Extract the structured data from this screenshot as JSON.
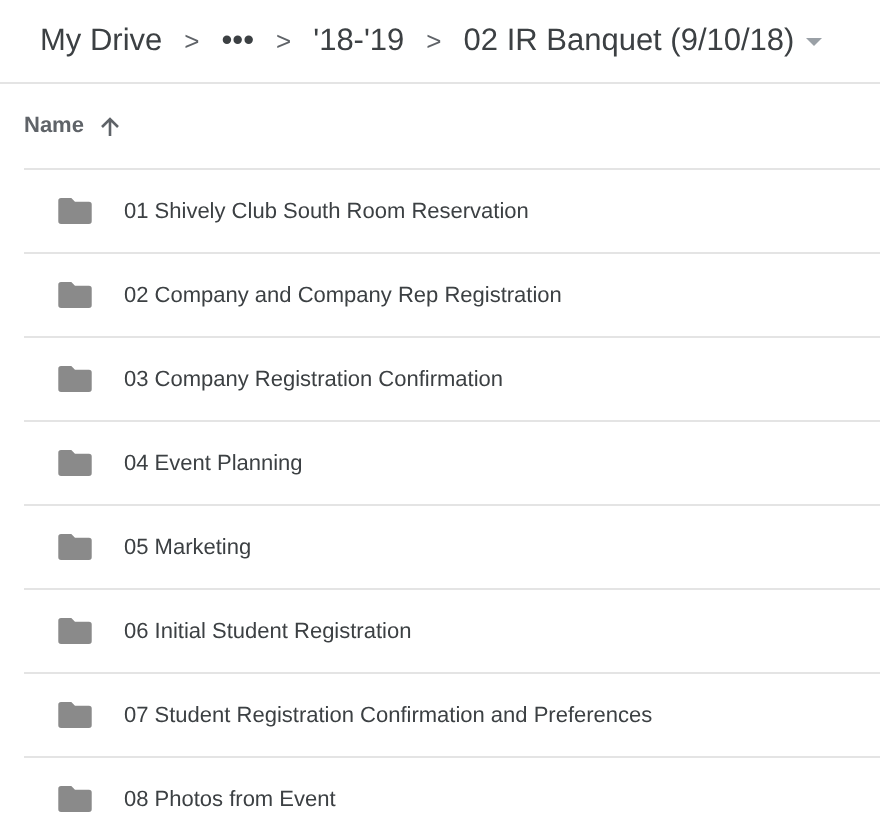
{
  "breadcrumb": [
    {
      "kind": "link",
      "label": "My Drive"
    },
    {
      "kind": "separator",
      "label": ">"
    },
    {
      "kind": "link",
      "label": "•••"
    },
    {
      "kind": "separator",
      "label": ">"
    },
    {
      "kind": "link",
      "label": "'18-'19"
    },
    {
      "kind": "separator",
      "label": ">"
    },
    {
      "kind": "current",
      "label": "02 IR Banquet (9/10/18)"
    }
  ],
  "list_header": {
    "label": "Name"
  },
  "folders": [
    {
      "name": "01 Shively Club South Room Reservation"
    },
    {
      "name": "02 Company and Company Rep Registration"
    },
    {
      "name": "03 Company Registration Confirmation"
    },
    {
      "name": "04 Event Planning"
    },
    {
      "name": "05 Marketing"
    },
    {
      "name": "06 Initial Student Registration"
    },
    {
      "name": "07 Student Registration Confirmation and Preferences"
    },
    {
      "name": "08 Photos from Event"
    }
  ]
}
